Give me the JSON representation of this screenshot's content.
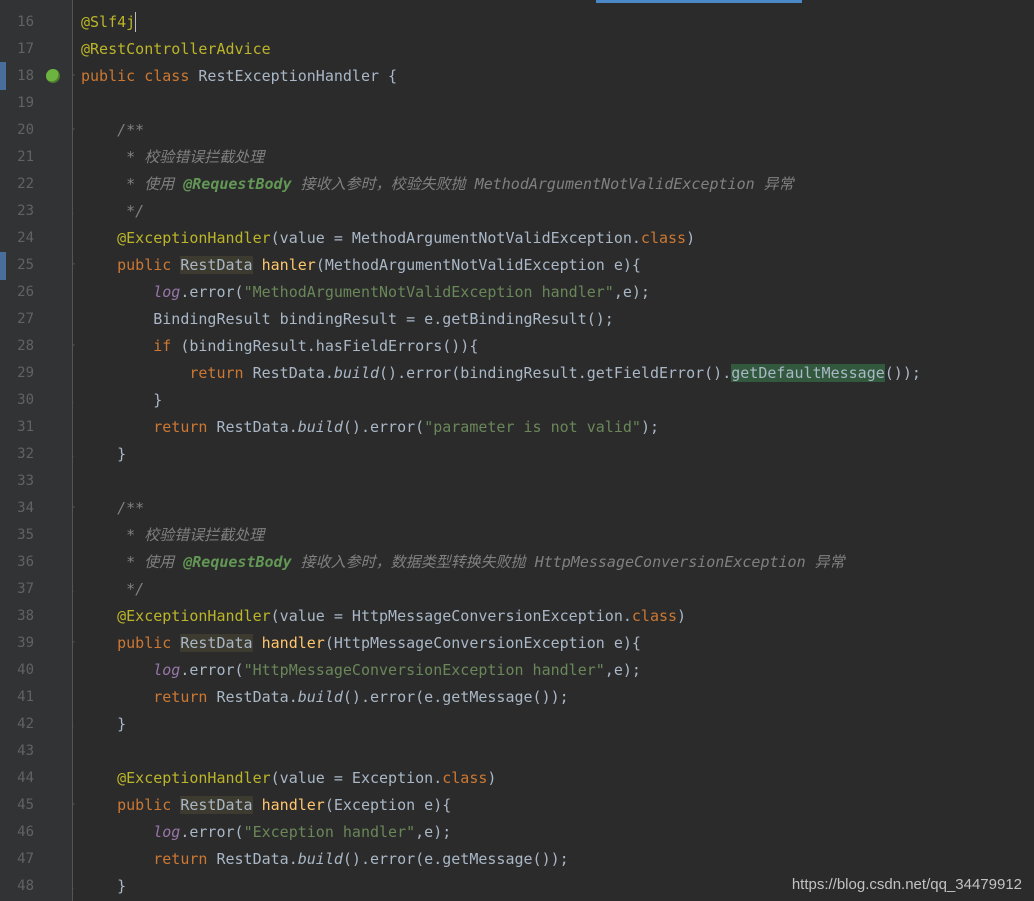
{
  "watermark": "https://blog.csdn.net/qq_34479912",
  "lines": [
    {
      "num": 16,
      "fold": "",
      "indent": 0,
      "tokens": [
        {
          "t": "ann",
          "v": "@Slf4j"
        },
        {
          "t": "caret",
          "v": ""
        }
      ]
    },
    {
      "num": 17,
      "fold": "",
      "indent": 0,
      "tokens": [
        {
          "t": "ann",
          "v": "@RestControllerAdvice"
        }
      ]
    },
    {
      "num": 18,
      "icon": "spring",
      "fold": "-",
      "indent": 0,
      "tokens": [
        {
          "t": "kw",
          "v": "public class "
        },
        {
          "t": "cls",
          "v": "RestExceptionHandler {"
        }
      ]
    },
    {
      "num": 19,
      "fold": "",
      "indent": 0,
      "tokens": []
    },
    {
      "num": 20,
      "fold": "-",
      "indent": 1,
      "tokens": [
        {
          "t": "cmt",
          "v": "/**"
        }
      ]
    },
    {
      "num": 21,
      "fold": "",
      "indent": 1,
      "tokens": [
        {
          "t": "cmt",
          "v": " * 校验错误拦截处理"
        }
      ]
    },
    {
      "num": 22,
      "fold": "",
      "indent": 1,
      "tokens": [
        {
          "t": "cmt",
          "v": " * 使用 "
        },
        {
          "t": "cmt-tag",
          "v": "@RequestBody"
        },
        {
          "t": "cmt",
          "v": " 接收入参时，校验失败抛 MethodArgumentNotValidException 异常"
        }
      ]
    },
    {
      "num": 23,
      "fold": "|",
      "indent": 1,
      "tokens": [
        {
          "t": "cmt",
          "v": " */"
        }
      ]
    },
    {
      "num": 24,
      "fold": "",
      "indent": 1,
      "tokens": [
        {
          "t": "ann",
          "v": "@ExceptionHandler"
        },
        {
          "t": "cls",
          "v": "(value = MethodArgumentNotValidException."
        },
        {
          "t": "kw",
          "v": "class"
        },
        {
          "t": "cls",
          "v": ")"
        }
      ]
    },
    {
      "num": 25,
      "fold": "-",
      "indent": 1,
      "tokens": [
        {
          "t": "kw",
          "v": "public "
        },
        {
          "t": "hl",
          "v": "RestData"
        },
        {
          "t": "cls",
          "v": " "
        },
        {
          "t": "mth",
          "v": "hanler"
        },
        {
          "t": "cls",
          "v": "(MethodArgumentNotValidException e){"
        }
      ]
    },
    {
      "num": 26,
      "fold": "",
      "indent": 2,
      "tokens": [
        {
          "t": "ital-field",
          "v": "log"
        },
        {
          "t": "cls",
          "v": ".error("
        },
        {
          "t": "str",
          "v": "\"MethodArgumentNotValidException handler\""
        },
        {
          "t": "cls",
          "v": ",e);"
        }
      ]
    },
    {
      "num": 27,
      "fold": "",
      "indent": 2,
      "tokens": [
        {
          "t": "cls",
          "v": "BindingResult bindingResult = e.getBindingResult();"
        }
      ]
    },
    {
      "num": 28,
      "fold": "-",
      "indent": 2,
      "tokens": [
        {
          "t": "kw",
          "v": "if "
        },
        {
          "t": "cls",
          "v": "(bindingResult.hasFieldErrors()){"
        }
      ]
    },
    {
      "num": 29,
      "fold": "",
      "indent": 3,
      "tokens": [
        {
          "t": "kw",
          "v": "return "
        },
        {
          "t": "cls",
          "v": "RestData."
        },
        {
          "t": "itl",
          "v": "build"
        },
        {
          "t": "cls",
          "v": "().error(bindingResult.getFieldError()."
        },
        {
          "t": "hl2",
          "v": "getDefaultMessage"
        },
        {
          "t": "cls",
          "v": "());"
        }
      ]
    },
    {
      "num": 30,
      "fold": "|",
      "indent": 2,
      "tokens": [
        {
          "t": "cls",
          "v": "}"
        }
      ]
    },
    {
      "num": 31,
      "fold": "",
      "indent": 2,
      "tokens": [
        {
          "t": "kw",
          "v": "return "
        },
        {
          "t": "cls",
          "v": "RestData."
        },
        {
          "t": "itl",
          "v": "build"
        },
        {
          "t": "cls",
          "v": "().error("
        },
        {
          "t": "str",
          "v": "\"parameter is not valid\""
        },
        {
          "t": "cls",
          "v": ");"
        }
      ]
    },
    {
      "num": 32,
      "fold": "|",
      "indent": 1,
      "tokens": [
        {
          "t": "cls",
          "v": "}"
        }
      ]
    },
    {
      "num": 33,
      "fold": "",
      "indent": 0,
      "tokens": []
    },
    {
      "num": 34,
      "fold": "-",
      "indent": 1,
      "tokens": [
        {
          "t": "cmt",
          "v": "/**"
        }
      ]
    },
    {
      "num": 35,
      "fold": "",
      "indent": 1,
      "tokens": [
        {
          "t": "cmt",
          "v": " * 校验错误拦截处理"
        }
      ]
    },
    {
      "num": 36,
      "fold": "",
      "indent": 1,
      "tokens": [
        {
          "t": "cmt",
          "v": " * 使用 "
        },
        {
          "t": "cmt-tag",
          "v": "@RequestBody"
        },
        {
          "t": "cmt",
          "v": " 接收入参时，数据类型转换失败抛 HttpMessageConversionException 异常"
        }
      ]
    },
    {
      "num": 37,
      "fold": "|",
      "indent": 1,
      "tokens": [
        {
          "t": "cmt",
          "v": " */"
        }
      ]
    },
    {
      "num": 38,
      "fold": "",
      "indent": 1,
      "tokens": [
        {
          "t": "ann",
          "v": "@ExceptionHandler"
        },
        {
          "t": "cls",
          "v": "(value = HttpMessageConversionException."
        },
        {
          "t": "kw",
          "v": "class"
        },
        {
          "t": "cls",
          "v": ")"
        }
      ]
    },
    {
      "num": 39,
      "fold": "-",
      "indent": 1,
      "tokens": [
        {
          "t": "kw",
          "v": "public "
        },
        {
          "t": "hl",
          "v": "RestData"
        },
        {
          "t": "cls",
          "v": " "
        },
        {
          "t": "mth",
          "v": "handler"
        },
        {
          "t": "cls",
          "v": "(HttpMessageConversionException e){"
        }
      ]
    },
    {
      "num": 40,
      "fold": "",
      "indent": 2,
      "tokens": [
        {
          "t": "ital-field",
          "v": "log"
        },
        {
          "t": "cls",
          "v": ".error("
        },
        {
          "t": "str",
          "v": "\"HttpMessageConversionException handler\""
        },
        {
          "t": "cls",
          "v": ",e);"
        }
      ]
    },
    {
      "num": 41,
      "fold": "",
      "indent": 2,
      "tokens": [
        {
          "t": "kw",
          "v": "return "
        },
        {
          "t": "cls",
          "v": "RestData."
        },
        {
          "t": "itl",
          "v": "build"
        },
        {
          "t": "cls",
          "v": "().error(e.getMessage());"
        }
      ]
    },
    {
      "num": 42,
      "fold": "|",
      "indent": 1,
      "tokens": [
        {
          "t": "cls",
          "v": "}"
        }
      ]
    },
    {
      "num": 43,
      "fold": "",
      "indent": 0,
      "tokens": []
    },
    {
      "num": 44,
      "fold": "",
      "indent": 1,
      "tokens": [
        {
          "t": "ann",
          "v": "@ExceptionHandler"
        },
        {
          "t": "cls",
          "v": "(value = Exception."
        },
        {
          "t": "kw",
          "v": "class"
        },
        {
          "t": "cls",
          "v": ")"
        }
      ]
    },
    {
      "num": 45,
      "fold": "-",
      "indent": 1,
      "tokens": [
        {
          "t": "kw",
          "v": "public "
        },
        {
          "t": "hl",
          "v": "RestData"
        },
        {
          "t": "cls",
          "v": " "
        },
        {
          "t": "mth",
          "v": "handler"
        },
        {
          "t": "cls",
          "v": "(Exception e){"
        }
      ]
    },
    {
      "num": 46,
      "fold": "",
      "indent": 2,
      "tokens": [
        {
          "t": "ital-field",
          "v": "log"
        },
        {
          "t": "cls",
          "v": ".error("
        },
        {
          "t": "str",
          "v": "\"Exception handler\""
        },
        {
          "t": "cls",
          "v": ",e);"
        }
      ]
    },
    {
      "num": 47,
      "fold": "",
      "indent": 2,
      "tokens": [
        {
          "t": "kw",
          "v": "return "
        },
        {
          "t": "cls",
          "v": "RestData."
        },
        {
          "t": "itl",
          "v": "build"
        },
        {
          "t": "cls",
          "v": "().error(e.getMessage());"
        }
      ]
    },
    {
      "num": 48,
      "fold": "|",
      "indent": 1,
      "tokens": [
        {
          "t": "cls",
          "v": "}"
        }
      ]
    }
  ]
}
